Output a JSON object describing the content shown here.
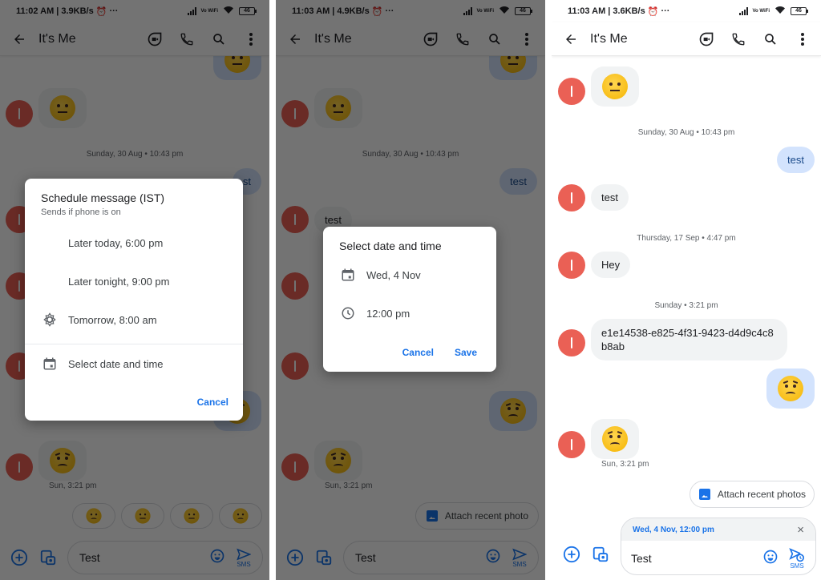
{
  "colors": {
    "accent": "#1a73e8",
    "avatar": "#ea6055",
    "incoming_bubble": "#f1f3f4",
    "outgoing_bubble": "#d3e3fd"
  },
  "screens": [
    {
      "status": {
        "time": "11:02 AM",
        "speed": "3.9KB/s",
        "volte": "Vo WiFi",
        "battery": "46"
      },
      "appbar": {
        "title": "It's Me",
        "icons": [
          "back-arrow-icon",
          "duo-video-icon",
          "phone-icon",
          "search-icon",
          "more-vert-icon"
        ]
      },
      "messages": {
        "date_separator": "Sunday, 30 Aug • 10:43 pm",
        "out_partial": "st",
        "last_time": "Sun, 3:21 pm"
      },
      "smart_replies": [
        "worried-face",
        "expressionless-face",
        "smiling-face",
        "disappointed-face"
      ],
      "composer": {
        "value": "Test",
        "send_label": "SMS"
      },
      "dialog": {
        "title": "Schedule message (IST)",
        "subtitle": "Sends if phone is on",
        "options": [
          {
            "icon": "moon-icon",
            "label": "Later today, 6:00 pm"
          },
          {
            "icon": "moon-icon",
            "label": "Later tonight, 9:00 pm"
          },
          {
            "icon": "sun-icon",
            "label": "Tomorrow, 8:00 am"
          },
          {
            "icon": "calendar-icon",
            "label": "Select date and time"
          }
        ],
        "cancel": "Cancel"
      }
    },
    {
      "status": {
        "time": "11:03 AM",
        "speed": "4.9KB/s",
        "volte": "Vo WiFi",
        "battery": "46"
      },
      "appbar": {
        "title": "It's Me"
      },
      "messages": {
        "date_separator": "Sunday, 30 Aug • 10:43 pm",
        "out_text": "test",
        "in_text": "test",
        "last_time": "Sun, 3:21 pm"
      },
      "attach_chip": "Attach recent photo",
      "composer": {
        "value": "Test",
        "send_label": "SMS"
      },
      "dialog": {
        "title": "Select date and time",
        "date": "Wed, 4 Nov",
        "time": "12:00 pm",
        "cancel": "Cancel",
        "save": "Save"
      }
    },
    {
      "status": {
        "time": "11:03 AM",
        "speed": "3.6KB/s",
        "volte": "Vo WiFi",
        "battery": "46"
      },
      "appbar": {
        "title": "It's Me"
      },
      "messages": {
        "sep1": "Sunday, 30 Aug • 10:43 pm",
        "out1": "test",
        "in1": "test",
        "sep2": "Thursday, 17 Sep • 4:47 pm",
        "in2": "Hey",
        "sep3": "Sunday • 3:21 pm",
        "in3": "e1e14538-e825-4f31-9423-d4d9c4c8b8ab",
        "last_time": "Sun, 3:21 pm"
      },
      "attach_chip": "Attach recent photos",
      "scheduled": {
        "label": "Wed, 4 Nov, 12:00 pm",
        "close": "×"
      },
      "composer": {
        "value": "Test",
        "send_label": "SMS"
      }
    }
  ]
}
